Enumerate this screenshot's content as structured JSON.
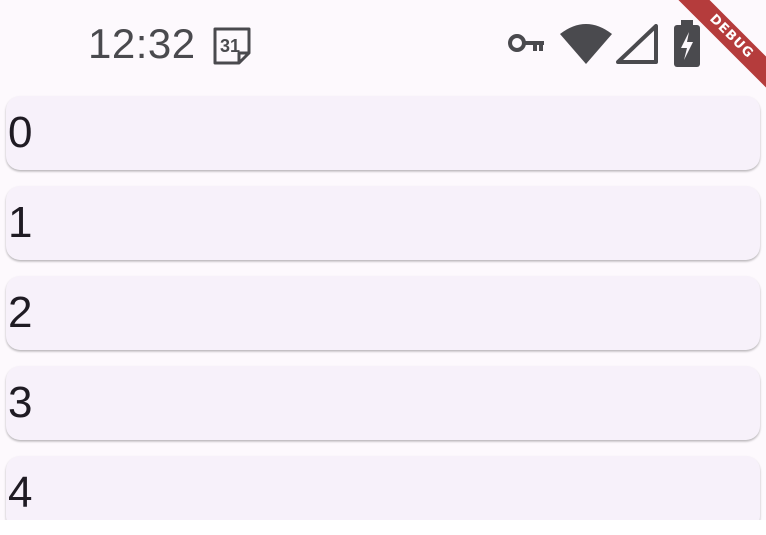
{
  "status_bar": {
    "time": "12:32",
    "calendar_day": "31",
    "icons": [
      "key-icon",
      "wifi-icon",
      "signal-icon",
      "battery-charging-icon"
    ]
  },
  "debug_banner": {
    "label": "DEBUG",
    "color": "#b53c3c"
  },
  "list": {
    "items": [
      {
        "label": "0"
      },
      {
        "label": "1"
      },
      {
        "label": "2"
      },
      {
        "label": "3"
      },
      {
        "label": "4"
      }
    ]
  },
  "colors": {
    "background": "#fdf9fd",
    "card": "#f7f1fa",
    "text": "#1f1b23"
  }
}
